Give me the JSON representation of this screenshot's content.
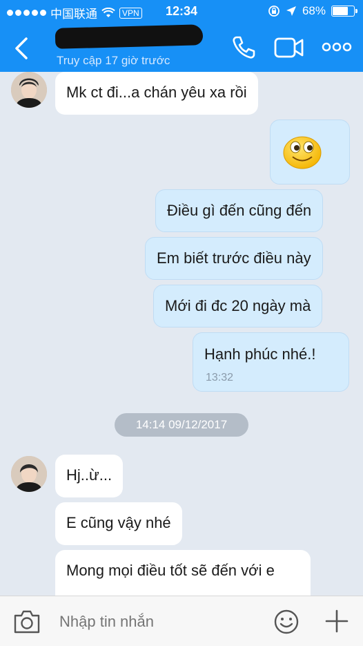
{
  "status_bar": {
    "carrier": "中国联通",
    "vpn": "VPN",
    "time": "12:34",
    "battery": "68%",
    "battery_level": 0.68
  },
  "header": {
    "contact_status": "Truy cập 17 giờ trước",
    "accent_color": "#1790f6"
  },
  "messages": [
    {
      "side": "in",
      "text": "Mk ct đi...a chán yêu xa rồi"
    },
    {
      "side": "out",
      "emoji": "smiley-face"
    },
    {
      "side": "out",
      "text": "Điều gì đến cũng đến"
    },
    {
      "side": "out",
      "text": "Em biết trước điều này"
    },
    {
      "side": "out",
      "text": "Mới đi đc 20 ngày mà"
    },
    {
      "side": "out",
      "text": "Hạnh phúc nhé.!",
      "time": "13:32"
    },
    {
      "side": "in",
      "text": "Hj..ừ..."
    },
    {
      "side": "in",
      "text": "E cũng vậy nhé"
    },
    {
      "side": "in",
      "text": "Mong mọi điều tốt sẽ đến với e"
    }
  ],
  "date_separator": "14:14 09/12/2017",
  "input": {
    "placeholder": "Nhập tin nhắn"
  }
}
